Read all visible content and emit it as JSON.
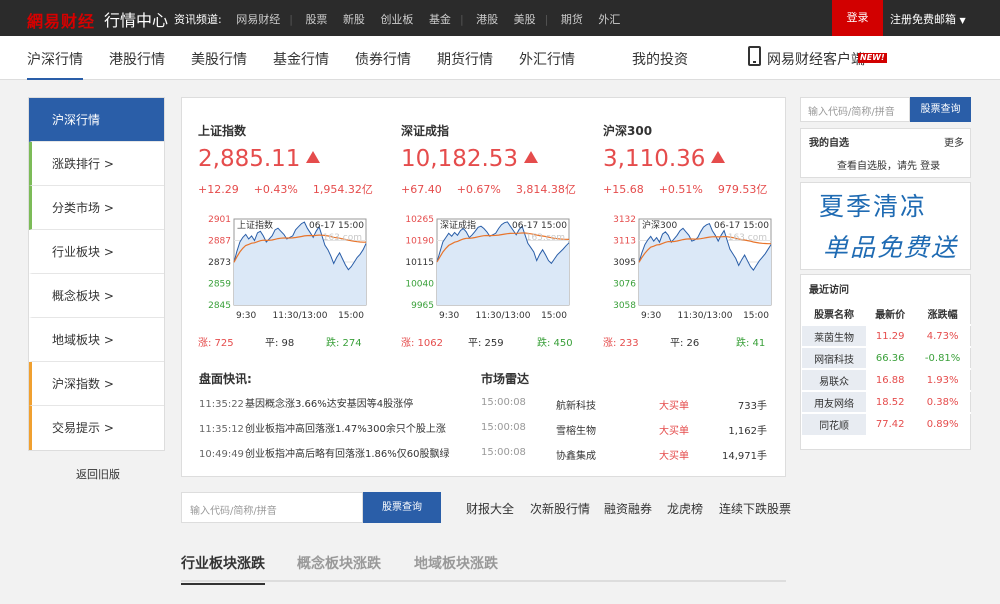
{
  "topbar": {
    "logo_brand": "網易",
    "logo_fin": "财经",
    "center": "行情中心",
    "channels_label": "资讯频道:",
    "channels": [
      "网易财经",
      "股票",
      "新股",
      "创业板",
      "基金",
      "港股",
      "美股",
      "期货",
      "外汇"
    ],
    "login": "登录",
    "register": "注册免费邮箱"
  },
  "nav": {
    "items": [
      "沪深行情",
      "港股行情",
      "美股行情",
      "基金行情",
      "债券行情",
      "期货行情",
      "外汇行情",
      "我的投资"
    ],
    "client": "网易财经客户端",
    "new_badge": "NEW!"
  },
  "sidebar": {
    "items": [
      "沪深行情",
      "涨跌排行 >",
      "分类市场 >",
      "行业板块 >",
      "概念板块 >",
      "地域板块 >",
      "沪深指数 >",
      "交易提示 >"
    ],
    "old_version": "返回旧版"
  },
  "indices": [
    {
      "name": "上证指数",
      "price": "2,885.11",
      "change": "+12.29",
      "pct": "+0.43%",
      "amount": "1,954.32亿",
      "chart_label": "上证指数",
      "chart_date": "06-17 15:00",
      "watermark": "163.com",
      "yticks": [
        "2901",
        "2887",
        "2873",
        "2859",
        "2845"
      ],
      "xticks": [
        "9:30",
        "11:30/13:00",
        "15:00"
      ],
      "up_label": "涨: 725",
      "flat_label": "平: 98",
      "down_label": "跌: 274",
      "prev_close": 2872.8,
      "chart_data": {
        "type": "line",
        "ylim": [
          2845,
          2901
        ],
        "y": [
          2872.8,
          2880,
          2886,
          2889,
          2891,
          2888,
          2890,
          2887,
          2892,
          2893,
          2890,
          2886,
          2888,
          2890,
          2894,
          2895,
          2893,
          2891,
          2888,
          2889,
          2890,
          2894,
          2896,
          2898,
          2899,
          2895,
          2892,
          2889,
          2893,
          2896,
          2890,
          2884,
          2881,
          2877,
          2872,
          2876,
          2879,
          2875,
          2871,
          2868,
          2870,
          2873,
          2876,
          2878,
          2881,
          2885
        ]
      }
    },
    {
      "name": "深证成指",
      "price": "10,182.53",
      "change": "+67.40",
      "pct": "+0.67%",
      "amount": "3,814.38亿",
      "chart_label": "深证成指",
      "chart_date": "06-17 15:00",
      "watermark": "163.com",
      "yticks": [
        "10265",
        "10190",
        "10115",
        "10040",
        "9965"
      ],
      "xticks": [
        "9:30",
        "11:30/13:00",
        "15:00"
      ],
      "up_label": "涨: 1062",
      "flat_label": "平: 259",
      "down_label": "跌: 450",
      "prev_close": 10115,
      "chart_data": {
        "type": "line",
        "ylim": [
          9965,
          10265
        ],
        "y": [
          10115,
          10150,
          10185,
          10200,
          10215,
          10205,
          10218,
          10208,
          10225,
          10232,
          10220,
          10200,
          10210,
          10222,
          10236,
          10240,
          10232,
          10220,
          10205,
          10210,
          10215,
          10232,
          10245,
          10252,
          10255,
          10240,
          10225,
          10210,
          10228,
          10240,
          10210,
          10180,
          10165,
          10150,
          10120,
          10142,
          10158,
          10140,
          10120,
          10110,
          10125,
          10140,
          10150,
          10160,
          10172,
          10182
        ]
      }
    },
    {
      "name": "沪深300",
      "price": "3,110.36",
      "change": "+15.68",
      "pct": "+0.51%",
      "amount": "979.53亿",
      "chart_label": "沪深300",
      "chart_date": "06-17 15:00",
      "watermark": "163.com",
      "yticks": [
        "3132",
        "3113",
        "3095",
        "3076",
        "3058"
      ],
      "xticks": [
        "9:30",
        "11:30/13:00",
        "15:00"
      ],
      "up_label": "涨: 233",
      "flat_label": "平: 26",
      "down_label": "跌: 41",
      "prev_close": 3094.7,
      "chart_data": {
        "type": "line",
        "ylim": [
          3058,
          3132
        ],
        "y": [
          3094.7,
          3103,
          3110,
          3114,
          3117,
          3113,
          3116,
          3112,
          3119,
          3121,
          3118,
          3112,
          3115,
          3118,
          3122,
          3124,
          3121,
          3118,
          3113,
          3114,
          3116,
          3121,
          3125,
          3127,
          3128,
          3122,
          3118,
          3113,
          3118,
          3122,
          3114,
          3106,
          3102,
          3098,
          3092,
          3097,
          3101,
          3096,
          3091,
          3088,
          3092,
          3096,
          3099,
          3102,
          3106,
          3110
        ]
      }
    }
  ],
  "flash": {
    "title": "盘面快讯:",
    "items": [
      {
        "time": "11:35:22",
        "text": "基因概念涨3.66%达安基因等4股涨停"
      },
      {
        "time": "11:35:12",
        "text": "创业板指冲高回落涨1.47%300余只个股上涨"
      },
      {
        "time": "10:49:49",
        "text": "创业板指冲高后略有回落涨1.86%仅60股飘绿"
      }
    ]
  },
  "radar": {
    "title": "市场雷达",
    "items": [
      {
        "time": "15:00:08",
        "name": "航新科技",
        "type": "大买单",
        "vol": "733手"
      },
      {
        "time": "15:00:08",
        "name": "雪榕生物",
        "type": "大买单",
        "vol": "1,162手"
      },
      {
        "time": "15:00:08",
        "name": "协鑫集成",
        "type": "大买单",
        "vol": "14,971手"
      }
    ]
  },
  "search2": {
    "placeholder": "输入代码/简称/拼音",
    "button": "股票查询"
  },
  "quick_links": [
    "财报大全",
    "次新股行情",
    "融资融券",
    "龙虎榜",
    "连续下跌股票"
  ],
  "board_tabs": [
    "行业板块涨跌",
    "概念板块涨跌",
    "地域板块涨跌"
  ],
  "right": {
    "search_placeholder": "输入代码/简称/拼音",
    "search_button": "股票查询",
    "fav_title": "我的自选",
    "fav_more": "更多",
    "fav_msg": "查看自选股，请先 登录",
    "banner_line1": "夏季清凉",
    "banner_line2": "单品免费送",
    "recent_title": "最近访问",
    "recent_headers": [
      "股票名称",
      "最新价",
      "涨跌幅"
    ],
    "recent_rows": [
      {
        "name": "莱茵生物",
        "price": "11.29",
        "pct": "4.73%",
        "dir": "up"
      },
      {
        "name": "网宿科技",
        "price": "66.36",
        "pct": "-0.81%",
        "dir": "down"
      },
      {
        "name": "易联众",
        "price": "16.88",
        "pct": "1.93%",
        "dir": "up"
      },
      {
        "name": "用友网络",
        "price": "18.52",
        "pct": "0.38%",
        "dir": "up"
      },
      {
        "name": "同花顺",
        "price": "77.42",
        "pct": "0.89%",
        "dir": "up"
      }
    ]
  },
  "colors": {
    "accent": "#2a5ea8",
    "red": "#e54c4c",
    "green": "#3aa03a",
    "login_red": "#d20000"
  }
}
